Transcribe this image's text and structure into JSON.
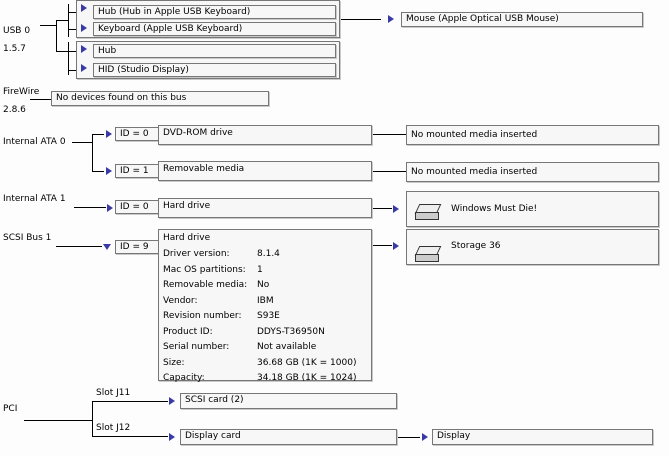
{
  "usb": {
    "name": "USB 0",
    "version": "1.5.7",
    "devices": [
      "Hub (Hub in Apple USB Keyboard)",
      "Keyboard (Apple USB Keyboard)",
      "Hub",
      "HID (Studio Display)"
    ],
    "mouse": "Mouse (Apple Optical USB Mouse)"
  },
  "firewire": {
    "name": "FireWire",
    "version": "2.8.6",
    "status": "No devices found on this bus"
  },
  "ata0": {
    "name": "Internal ATA 0",
    "devices": [
      {
        "id": "ID = 0",
        "name": "DVD-ROM drive",
        "media": "No mounted media inserted"
      },
      {
        "id": "ID = 1",
        "name": "Removable media",
        "media": "No mounted media inserted"
      }
    ]
  },
  "ata1": {
    "name": "Internal ATA 1",
    "id": "ID = 0",
    "device": "Hard drive",
    "volume": "Windows Must Die!"
  },
  "scsi": {
    "name": "SCSI Bus 1",
    "id": "ID = 9",
    "device": "Hard drive",
    "volume": "Storage 36",
    "details": [
      {
        "key": "Driver version:",
        "value": "8.1.4"
      },
      {
        "key": "Mac OS partitions:",
        "value": "1"
      },
      {
        "key": "Removable media:",
        "value": "No"
      },
      {
        "key": "Vendor:",
        "value": "IBM"
      },
      {
        "key": "Revision number:",
        "value": "S93E"
      },
      {
        "key": "Product ID:",
        "value": "DDYS-T36950N"
      },
      {
        "key": "Serial number:",
        "value": "Not available"
      },
      {
        "key": "Size:",
        "value": "36.68 GB (1K = 1000)"
      },
      {
        "key": "Capacity:",
        "value": "34.18 GB (1K = 1024)"
      }
    ]
  },
  "pci": {
    "name": "PCI",
    "slot1": "Slot J11",
    "slot1_card": "SCSI card (2)",
    "slot2": "Slot J12",
    "slot2_card": "Display card",
    "display": "Display"
  },
  "colors": {
    "triangle": "#3a3aa6",
    "border": "#777777"
  }
}
